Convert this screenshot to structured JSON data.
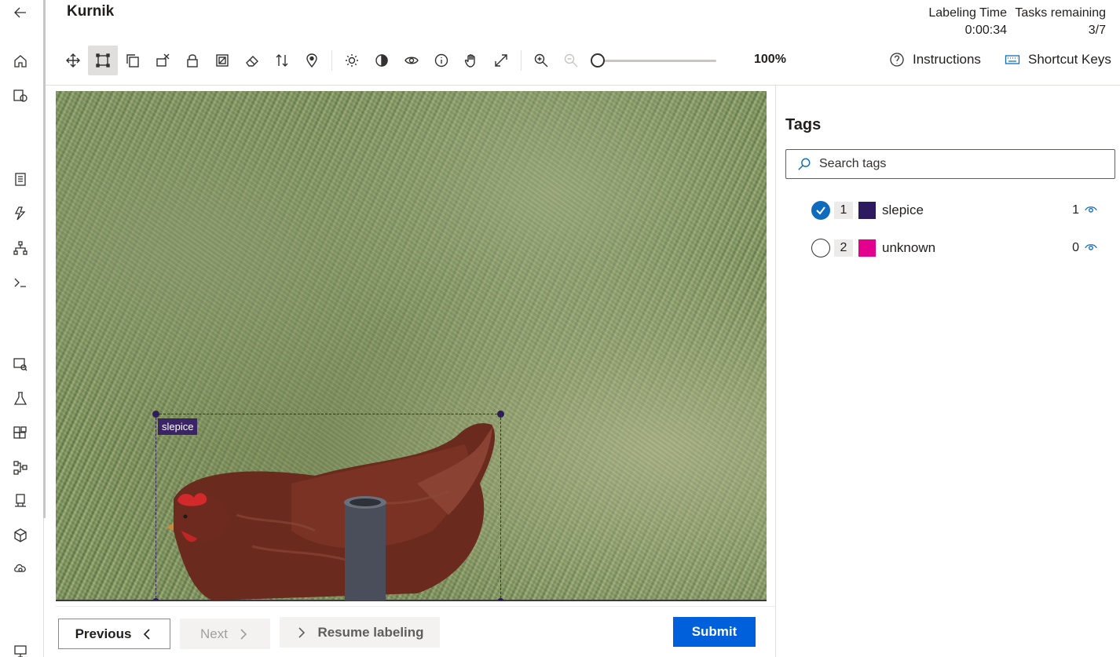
{
  "app": {
    "title": "Kurnik"
  },
  "header": {
    "labeling_time_label": "Labeling Time",
    "labeling_time_value": "0:00:34",
    "tasks_remaining_label": "Tasks remaining",
    "tasks_remaining_value": "3/7"
  },
  "toolbar": {
    "zoom_value": "100%",
    "zoom_slider_fraction": 0,
    "instructions_label": "Instructions",
    "shortcut_keys_label": "Shortcut Keys",
    "tools": [
      "move-icon",
      "rectangle-icon",
      "copy-icon",
      "remove-box-icon",
      "lock-icon",
      "region-icon",
      "eraser-icon",
      "sort-icon",
      "pin-icon",
      "brightness-icon",
      "contrast-icon",
      "eye-icon",
      "info-icon",
      "hand-icon",
      "fit-icon",
      "zoom-in-icon",
      "zoom-out-icon"
    ]
  },
  "canvas": {
    "annotation_label": "slepice",
    "annotation_color": "#3b2466"
  },
  "navigation": {
    "previous_label": "Previous",
    "next_label": "Next",
    "resume_label": "Resume labeling",
    "submit_label": "Submit"
  },
  "tags_panel": {
    "title": "Tags",
    "search_placeholder": "Search tags",
    "tags": [
      {
        "key": "1",
        "name": "slepice",
        "color": "#2e1a5e",
        "count": "1",
        "selected": true
      },
      {
        "key": "2",
        "name": "unknown",
        "color": "#e3008c",
        "count": "0",
        "selected": false
      }
    ]
  },
  "colors": {
    "accent": "#0f6cbd",
    "submit": "#005fdb"
  }
}
